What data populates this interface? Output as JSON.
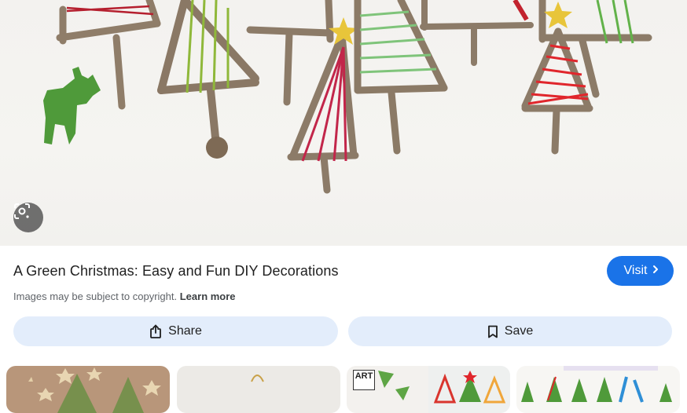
{
  "result": {
    "title": "A Green Christmas: Easy and Fun DIY Decorations",
    "visit_label": "Visit",
    "copyright_text": "Images may be subject to copyright.",
    "learn_more_label": "Learn more"
  },
  "actions": {
    "share_label": "Share",
    "save_label": "Save"
  },
  "thumbnails": {
    "items": [
      {
        "name": "stick-trees-stars"
      },
      {
        "name": "string-ornament"
      },
      {
        "name": "art-all-the-way-trees",
        "badge_text": "ART"
      },
      {
        "name": "classroom-stem-trees"
      }
    ]
  },
  "icons": {
    "lens": "lens-search-icon",
    "visit_chevron": "chevron-right-icon",
    "share": "share-icon",
    "save": "bookmark-icon"
  },
  "colors": {
    "accent": "#1a73e8",
    "action_button_bg": "#e3edfb",
    "secondary_text": "#5f6368"
  }
}
